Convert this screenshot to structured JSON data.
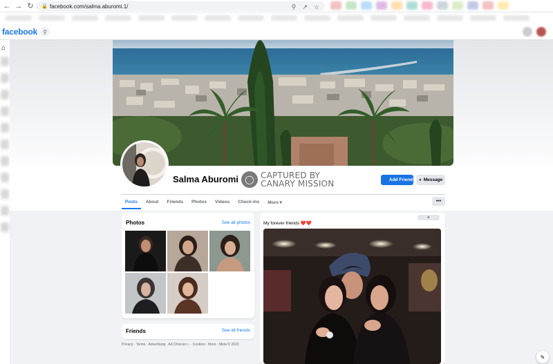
{
  "browser": {
    "url": "facebook.com/salma.aburomi.1/",
    "icons": [
      "back-icon",
      "forward-icon",
      "reload-icon",
      "lock-icon",
      "zoom-icon",
      "share-icon",
      "star-icon"
    ]
  },
  "topbar": {
    "logo": "facebook"
  },
  "profile": {
    "name": "Salma Aburomi",
    "watermark_line1": "CAPTURED BY",
    "watermark_line2": "CANARY MISSION",
    "add_friend": "Add Friend",
    "message": "Message",
    "more_dots": "•••"
  },
  "tabs": [
    "Posts",
    "About",
    "Friends",
    "Photos",
    "Videos",
    "Check-ins",
    "More ▾"
  ],
  "photos_card": {
    "title": "Photos",
    "see_all": "See all photos"
  },
  "friends_card": {
    "title": "Friends",
    "see_all": "See all friends"
  },
  "footer": "Privacy · Terms · Advertising · Ad Choices ▷ · Cookies · More · Meta © 2023",
  "post": {
    "caption": "My forever friends ❤️❤️"
  },
  "colors": {
    "brand": "#1877f2",
    "button_primary": "#1b74e4",
    "page_bg": "#f0f2f5"
  }
}
